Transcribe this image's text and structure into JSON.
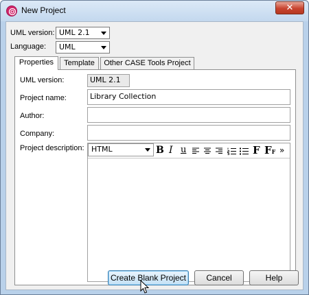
{
  "window": {
    "title": "New Project",
    "close_glyph": "✕"
  },
  "top": {
    "uml_version_label": "UML version:",
    "uml_version_value": "UML 2.1",
    "language_label": "Language:",
    "language_value": "UML"
  },
  "tabs": [
    {
      "label": "Properties"
    },
    {
      "label": "Template"
    },
    {
      "label": "Other CASE Tools Project"
    }
  ],
  "form": {
    "uml_version_label": "UML version:",
    "uml_version_value": "UML 2.1",
    "project_name_label": "Project name:",
    "project_name_value": "Library Collection",
    "author_label": "Author:",
    "author_value": "",
    "company_label": "Company:",
    "company_value": "",
    "description_label": "Project description:",
    "format_value": "HTML",
    "toolbar": {
      "bold": "B",
      "italic": "I",
      "underline": "u",
      "font": "F",
      "font_size": "F",
      "font_size_sub": "F",
      "more": "»"
    }
  },
  "buttons": {
    "create": "Create Blank Project",
    "cancel": "Cancel",
    "help": "Help"
  }
}
